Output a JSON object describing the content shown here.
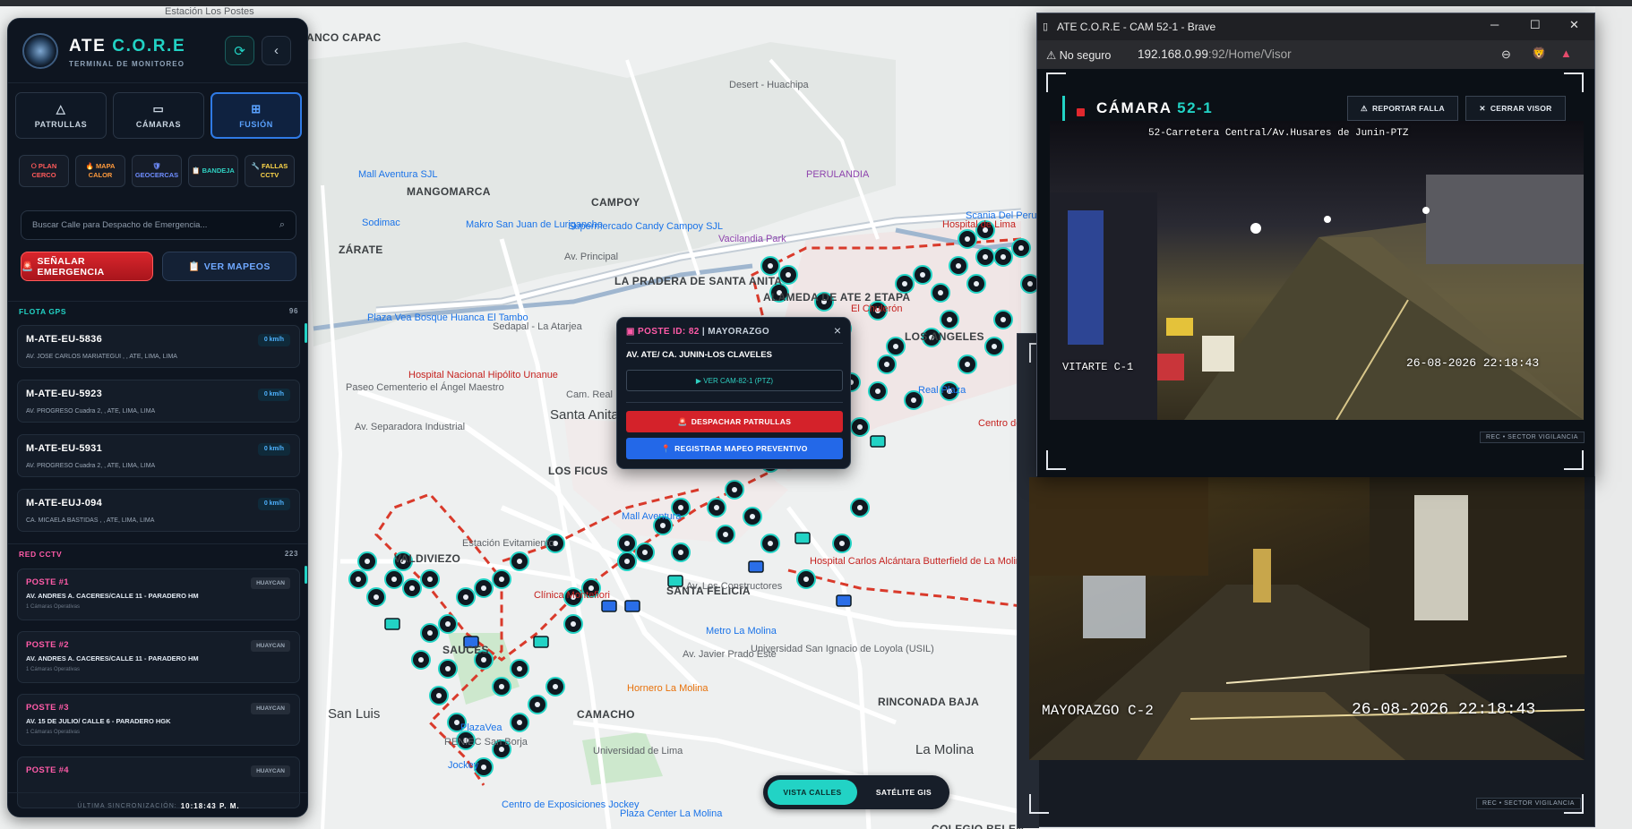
{
  "map": {
    "labels": [
      {
        "t": "Estación Los Postes",
        "c": ""
      },
      {
        "t": "ANCO CAPAC",
        "c": "mid"
      },
      {
        "t": "Mall Aventura SJL",
        "c": "poi"
      },
      {
        "t": "MANGOMARCA",
        "c": "mid"
      },
      {
        "t": "CAMPOY",
        "c": "mid"
      },
      {
        "t": "Sodimac",
        "c": "poi"
      },
      {
        "t": "Makro San Juan de Lurigancho",
        "c": "poi"
      },
      {
        "t": "Supermercado Candy Campoy SJL",
        "c": "poi"
      },
      {
        "t": "ZÁRATE",
        "c": "mid"
      },
      {
        "t": "Vacilandia Park",
        "c": "pur"
      },
      {
        "t": "Av. Principal",
        "c": ""
      },
      {
        "t": "LA PRADERA DE SANTA ANITA",
        "c": "mid"
      },
      {
        "t": "ALAMEDA DE ATE 2 ETAPA",
        "c": "mid"
      },
      {
        "t": "El Chulerón",
        "c": "red"
      },
      {
        "t": "LOS ANGELES",
        "c": "mid"
      },
      {
        "t": "Plaza Vea Bosque Huanca El Tambo",
        "c": "poi"
      },
      {
        "t": "Sedapal - La Atarjea",
        "c": ""
      },
      {
        "t": "Hospital Nacional Hipólito Unanue",
        "c": "red"
      },
      {
        "t": "Santa Anita",
        "c": "big"
      },
      {
        "t": "LOS FICUS",
        "c": "mid"
      },
      {
        "t": "Mall Aventura",
        "c": "poi"
      },
      {
        "t": "Estación Evitamiento",
        "c": ""
      },
      {
        "t": "VALDIVIEZO",
        "c": "mid"
      },
      {
        "t": "Clínica Montefiori",
        "c": "red"
      },
      {
        "t": "SANTA FELICIA",
        "c": "mid"
      },
      {
        "t": "Hospital Carlos Alcántara Butterfield de La Molina",
        "c": "red"
      },
      {
        "t": "Metro La Molina",
        "c": "poi"
      },
      {
        "t": "Universidad San Ignacio de Loyola (USIL)",
        "c": ""
      },
      {
        "t": "Hornero La Molina",
        "c": "org"
      },
      {
        "t": "RINCONADA BAJA",
        "c": "mid"
      },
      {
        "t": "San Luis",
        "c": "big"
      },
      {
        "t": "RENIEC San Borja",
        "c": ""
      },
      {
        "t": "CAMACHO",
        "c": "mid"
      },
      {
        "t": "La Molina",
        "c": "big"
      },
      {
        "t": "Plaza Center La Molina",
        "c": "poi"
      },
      {
        "t": "Jockey",
        "c": "poi"
      },
      {
        "t": "Universidad de Lima",
        "c": ""
      },
      {
        "t": "Centro de Exposiciones Jockey",
        "c": "poi"
      },
      {
        "t": "COLEGIO BELEN",
        "c": "mid"
      },
      {
        "t": "Desert - Huachipa",
        "c": ""
      },
      {
        "t": "PERULANDIA",
        "c": "pur"
      },
      {
        "t": "Scania Del Peru",
        "c": "poi"
      },
      {
        "t": "Hospital de Lima",
        "c": "red"
      },
      {
        "t": "Real Plaza",
        "c": "poi"
      },
      {
        "t": "Centro de salud Alfa y omega Catalina",
        "c": "red"
      },
      {
        "t": "Cam. Real",
        "c": ""
      },
      {
        "t": "Paseo Cementerio el Ángel Maestro",
        "c": ""
      },
      {
        "t": "Av. Los Constructores",
        "c": ""
      },
      {
        "t": "Av. Javier Prado Este",
        "c": ""
      },
      {
        "t": "SAUCES",
        "c": "mid"
      },
      {
        "t": "PlazaVea",
        "c": "poi"
      },
      {
        "t": "Av. Separadora Industrial",
        "c": ""
      }
    ]
  },
  "sidebar": {
    "brand_a": "ATE ",
    "brand_b": "C.O.R.E",
    "subtitle": "TERMINAL DE MONITOREO",
    "refresh_icon": "refresh-icon",
    "collapse_icon": "chevron-left-icon",
    "tabs": [
      {
        "label": "PATRULLAS",
        "icon": "warning-triangle-icon"
      },
      {
        "label": "CÁMARAS",
        "icon": "video-camera-icon"
      },
      {
        "label": "FUSIÓN",
        "icon": "grid-icon"
      }
    ],
    "chips": [
      {
        "l1": "⭘ PLAN",
        "l2": "CERCO",
        "color": "#ff5a5a"
      },
      {
        "l1": "🔥 MAPA",
        "l2": "CALOR",
        "color": "#ff9a3c"
      },
      {
        "l1": "🛡",
        "l2": "GEOCERCAS",
        "color": "#6f8dff"
      },
      {
        "l1": "📋 BANDEJA",
        "l2": "",
        "color": "#2fd0c2"
      },
      {
        "l1": "🔧 FALLAS",
        "l2": "CCTV",
        "color": "#ffd84a"
      }
    ],
    "search_placeholder": "Buscar Calle para Despacho de Emergencia...",
    "emergency_label": "SEÑALAR EMERGENCIA",
    "mappings_label": "VER MAPEOS",
    "fleet_title": "FLOTA GPS",
    "fleet_count": "96",
    "fleet": [
      {
        "id": "M-ATE-EU-5836",
        "speed": "0 km/h",
        "addr": "AV. JOSE CARLOS MARIATEGUI , , ATE, LIMA, LIMA"
      },
      {
        "id": "M-ATE-EU-5923",
        "speed": "0 km/h",
        "addr": "AV. PROGRESO Cuadra 2, , ATE, LIMA, LIMA"
      },
      {
        "id": "M-ATE-EU-5931",
        "speed": "0 km/h",
        "addr": "AV. PROGRESO Cuadra 2, , ATE, LIMA, LIMA"
      },
      {
        "id": "M-ATE-EUJ-094",
        "speed": "0 km/h",
        "addr": "CA. MICAELA BASTIDAS , , ATE, LIMA, LIMA"
      }
    ],
    "cctv_title": "RED CCTV",
    "cctv_count": "223",
    "posts": [
      {
        "name": "POSTE #1",
        "zone": "HUAYCAN",
        "addr": "AV. ANDRES A. CACERES/CALLE 11 - PARADERO HM",
        "sub": "1 Cámaras Operativas"
      },
      {
        "name": "POSTE #2",
        "zone": "HUAYCAN",
        "addr": "AV. ANDRES A. CACERES/CALLE 11 - PARADERO HM",
        "sub": "1 Cámaras Operativas"
      },
      {
        "name": "POSTE #3",
        "zone": "HUAYCAN",
        "addr": "AV. 15 DE JULIO/ CALLE 6 - PARADERO HGK",
        "sub": "1 Cámaras Operativas"
      },
      {
        "name": "POSTE #4",
        "zone": "HUAYCAN",
        "addr": "",
        "sub": ""
      }
    ],
    "sync_label": "ÚLTIMA SINCRONIZACIÓN:",
    "sync_time": "10:18:43 P. M."
  },
  "popup": {
    "title_a": "POSTE ID: 82",
    "title_b": " | MAYORAZGO",
    "address": "AV. ATE/ CA. JUNIN-LOS CLAVELES",
    "view_cam": "▶ VER CAM-82-1 (PTZ)",
    "dispatch": "DESPACHAR PATRULLAS",
    "register": "REGISTRAR MAPEO PREVENTIVO"
  },
  "view_toggle": {
    "streets": "VISTA CALLES",
    "satellite": "SATÉLITE GIS"
  },
  "brave": {
    "window_title": "ATE C.O.R.E - CAM 52-1 - Brave",
    "not_secure": "No seguro",
    "host": "192.168.0.99",
    "path": ":92/Home/Visor",
    "cam_title_a": "CÁMARA ",
    "cam_title_b": "52-1",
    "report_btn": "REPORTAR FALLA",
    "close_btn": "CERRAR VISOR",
    "overlay_top": "52-Carretera Central/Av.Husares de Junin-PTZ",
    "overlay_left": "VITARTE C-1",
    "overlay_time": "26-08-2026 22:18:43",
    "rec": "REC • SECTOR VIGILANCIA"
  },
  "camwin2": {
    "overlay_left": "MAYORAZGO C-2",
    "overlay_time": "26-08-2026 22:18:43",
    "rec": "REC • SECTOR VIGILANCIA"
  },
  "colors": {
    "accent": "#22d3c5",
    "danger": "#d4222a",
    "primary": "#2368e8",
    "pink": "#ff5ba8"
  }
}
